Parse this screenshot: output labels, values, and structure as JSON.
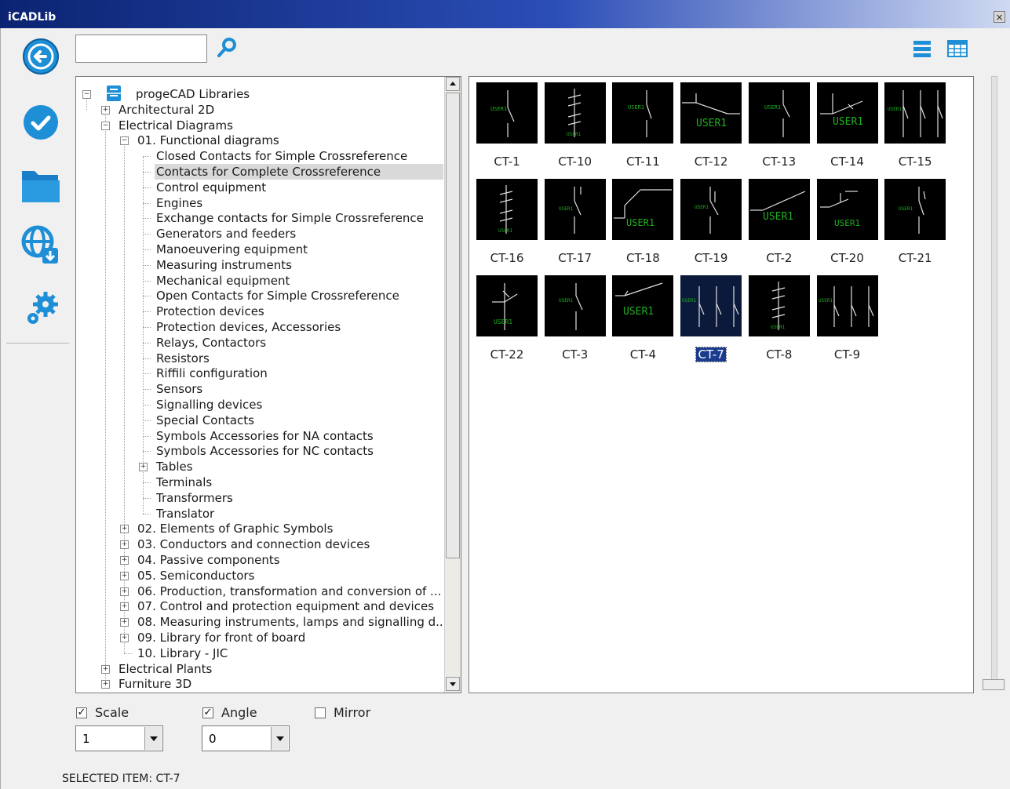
{
  "window": {
    "title": "iCADLib",
    "close_glyph": "×"
  },
  "toolbar": {
    "search": {
      "value": "",
      "placeholder": ""
    },
    "left_buttons": [
      {
        "name": "back-button",
        "icon": "back-arrow-icon"
      },
      {
        "name": "apply-button",
        "icon": "checkmark-icon"
      },
      {
        "name": "open-folder-button",
        "icon": "folder-icon"
      },
      {
        "name": "download-web-button",
        "icon": "globe-download-icon"
      },
      {
        "name": "settings-button",
        "icon": "gears-icon"
      }
    ],
    "view_buttons": [
      "list-view-icon",
      "grid-view-icon"
    ]
  },
  "tree": {
    "items": [
      {
        "label": "progeCAD Libraries",
        "depth": 0,
        "expander": "minus",
        "root": true
      },
      {
        "label": "Architectural 2D",
        "depth": 1,
        "expander": "plus"
      },
      {
        "label": "Electrical Diagrams",
        "depth": 1,
        "expander": "minus"
      },
      {
        "label": "01. Functional diagrams",
        "depth": 2,
        "expander": "minus"
      },
      {
        "label": "Closed Contacts for Simple Crossreference",
        "depth": 3,
        "expander": "none"
      },
      {
        "label": "Contacts for Complete Crossreference",
        "depth": 3,
        "expander": "none",
        "selected": true
      },
      {
        "label": "Control equipment",
        "depth": 3,
        "expander": "none"
      },
      {
        "label": "Engines",
        "depth": 3,
        "expander": "none"
      },
      {
        "label": "Exchange contacts for Simple Crossreference",
        "depth": 3,
        "expander": "none"
      },
      {
        "label": "Generators and feeders",
        "depth": 3,
        "expander": "none"
      },
      {
        "label": "Manoeuvering equipment",
        "depth": 3,
        "expander": "none"
      },
      {
        "label": "Measuring instruments",
        "depth": 3,
        "expander": "none"
      },
      {
        "label": "Mechanical equipment",
        "depth": 3,
        "expander": "none"
      },
      {
        "label": "Open Contacts for Simple Crossreference",
        "depth": 3,
        "expander": "none"
      },
      {
        "label": "Protection devices",
        "depth": 3,
        "expander": "none"
      },
      {
        "label": "Protection devices, Accessories",
        "depth": 3,
        "expander": "none"
      },
      {
        "label": "Relays, Contactors",
        "depth": 3,
        "expander": "none"
      },
      {
        "label": "Resistors",
        "depth": 3,
        "expander": "none"
      },
      {
        "label": "Riffili configuration",
        "depth": 3,
        "expander": "none"
      },
      {
        "label": "Sensors",
        "depth": 3,
        "expander": "none"
      },
      {
        "label": "Signalling devices",
        "depth": 3,
        "expander": "none"
      },
      {
        "label": "Special Contacts",
        "depth": 3,
        "expander": "none"
      },
      {
        "label": "Symbols Accessories for NA contacts",
        "depth": 3,
        "expander": "none"
      },
      {
        "label": "Symbols Accessories for NC contacts",
        "depth": 3,
        "expander": "none"
      },
      {
        "label": "Tables",
        "depth": 3,
        "expander": "plus"
      },
      {
        "label": "Terminals",
        "depth": 3,
        "expander": "none"
      },
      {
        "label": "Transformers",
        "depth": 3,
        "expander": "none"
      },
      {
        "label": "Translator",
        "depth": 3,
        "expander": "none"
      },
      {
        "label": "02. Elements of Graphic Symbols",
        "depth": 2,
        "expander": "plus"
      },
      {
        "label": "03. Conductors and connection devices",
        "depth": 2,
        "expander": "plus"
      },
      {
        "label": "04. Passive components",
        "depth": 2,
        "expander": "plus"
      },
      {
        "label": "05. Semiconductors",
        "depth": 2,
        "expander": "plus"
      },
      {
        "label": "06. Production, transformation and conversion of ...",
        "depth": 2,
        "expander": "plus"
      },
      {
        "label": "07. Control and protection equipment and devices",
        "depth": 2,
        "expander": "plus"
      },
      {
        "label": "08. Measuring instruments, lamps and signalling d...",
        "depth": 2,
        "expander": "plus"
      },
      {
        "label": "09. Library for front of board",
        "depth": 2,
        "expander": "plus"
      },
      {
        "label": "10. Library - JIC",
        "depth": 2,
        "expander": "none"
      },
      {
        "label": "Electrical Plants",
        "depth": 1,
        "expander": "plus"
      },
      {
        "label": "Furniture 3D",
        "depth": 1,
        "expander": "plus"
      }
    ]
  },
  "grid": {
    "thumb_line_color": "#e0e0e0",
    "thumb_text_color": "#1fae1f",
    "tiles": [
      {
        "label": "CT-1",
        "kind": "ct1",
        "text": "USER1"
      },
      {
        "label": "CT-10",
        "kind": "ct10",
        "text": "USER1"
      },
      {
        "label": "CT-11",
        "kind": "ct11",
        "text": "USER1"
      },
      {
        "label": "CT-12",
        "kind": "ct12",
        "text": "USER1"
      },
      {
        "label": "CT-13",
        "kind": "ct13",
        "text": "USER1"
      },
      {
        "label": "CT-14",
        "kind": "ct14",
        "text": "USER1"
      },
      {
        "label": "CT-15",
        "kind": "ct15",
        "text": "USER1"
      },
      {
        "label": "CT-16",
        "kind": "ct16",
        "text": "USER1"
      },
      {
        "label": "CT-17",
        "kind": "ct17",
        "text": "USER1"
      },
      {
        "label": "CT-18",
        "kind": "ct18",
        "text": "USER1"
      },
      {
        "label": "CT-19",
        "kind": "ct19",
        "text": "USER1"
      },
      {
        "label": "CT-2",
        "kind": "ct2",
        "text": "USER1"
      },
      {
        "label": "CT-20",
        "kind": "ct20",
        "text": "USER1"
      },
      {
        "label": "CT-21",
        "kind": "ct21",
        "text": "USER1"
      },
      {
        "label": "CT-22",
        "kind": "ct22",
        "text": "USER1"
      },
      {
        "label": "CT-3",
        "kind": "ct3",
        "text": "USER1"
      },
      {
        "label": "CT-4",
        "kind": "ct4",
        "text": "USER1"
      },
      {
        "label": "CT-7",
        "kind": "ct7",
        "text": "USER1",
        "selected": true
      },
      {
        "label": "CT-8",
        "kind": "ct8",
        "text": "USER1"
      },
      {
        "label": "CT-9",
        "kind": "ct9",
        "text": "USER1"
      }
    ]
  },
  "options": {
    "scale": {
      "label": "Scale",
      "checked": true,
      "value": "1"
    },
    "angle": {
      "label": "Angle",
      "checked": true,
      "value": "0"
    },
    "mirror": {
      "label": "Mirror",
      "checked": false
    }
  },
  "status": {
    "text": "SELECTED ITEM: CT-7"
  },
  "colors": {
    "accent": "#2b4db6",
    "icon_blue": "#1e8fd6",
    "selection": "#1a3b8e"
  }
}
